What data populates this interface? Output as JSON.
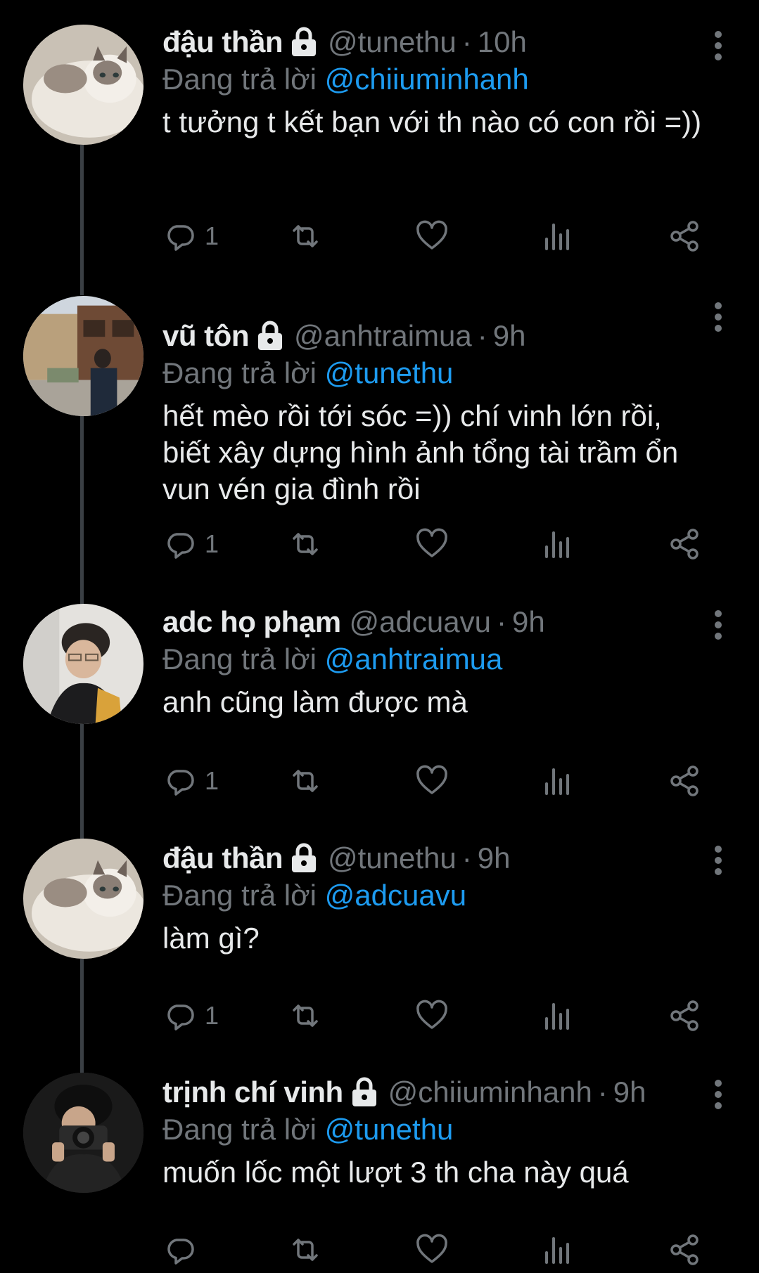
{
  "colors": {
    "background": "#000000",
    "text": "#e7e9ea",
    "muted": "#71767b",
    "accent": "#1d9bf0",
    "thread_line": "#3a3f44"
  },
  "reply_prefix": "Đang trả lời",
  "tweets": [
    {
      "name": "đậu thần",
      "locked": true,
      "handle": "@tunethu",
      "separator": "·",
      "time": "10h",
      "reply_to": "@chiiuminhanh",
      "text": "t tưởng t kết bạn với th nào có con rồi =))",
      "reply_count": "1",
      "avatar": "cat-photo"
    },
    {
      "name": "vũ tôn",
      "locked": true,
      "handle": "@anhtraimua",
      "separator": "·",
      "time": "9h",
      "reply_to": "@tunethu",
      "text": "hết mèo rồi tới sóc =)) chí vinh lớn rồi, biết xây dựng hình ảnh tổng tài trầm ổn vun vén gia đình rồi",
      "reply_count": "1",
      "avatar": "street-photo"
    },
    {
      "name": "adc họ phạm",
      "locked": false,
      "handle": "@adcuavu",
      "separator": "·",
      "time": "9h",
      "reply_to": "@anhtraimua",
      "text": "anh cũng làm được mà",
      "reply_count": "1",
      "avatar": "person-photo"
    },
    {
      "name": "đậu thần",
      "locked": true,
      "handle": "@tunethu",
      "separator": "·",
      "time": "9h",
      "reply_to": "@adcuavu",
      "text": "làm gì?",
      "reply_count": "1",
      "avatar": "cat-photo"
    },
    {
      "name": "trịnh chí vinh",
      "locked": true,
      "handle": "@chiiuminhanh",
      "separator": "·",
      "time": "9h",
      "reply_to": "@tunethu",
      "text": "muốn lốc một lượt 3 th cha này quá",
      "reply_count": "",
      "avatar": "camera-person-photo"
    }
  ]
}
